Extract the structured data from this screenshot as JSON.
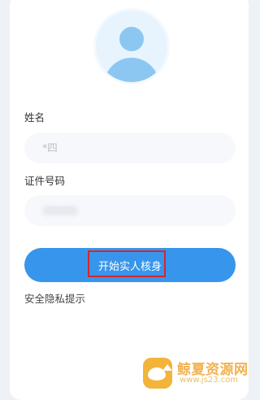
{
  "form": {
    "name_label": "姓名",
    "name_value": "*四",
    "id_label": "证件号码"
  },
  "actions": {
    "start_button": "开始实人核身",
    "privacy_link": "安全隐私提示"
  },
  "watermark": {
    "title": "鲸夏资源网",
    "url": "www.js23.com"
  },
  "colors": {
    "primary": "#3895ec",
    "highlight": "#d6262a",
    "avatar": "#8cc7f2"
  },
  "icons": {
    "avatar": "user-avatar-icon"
  }
}
